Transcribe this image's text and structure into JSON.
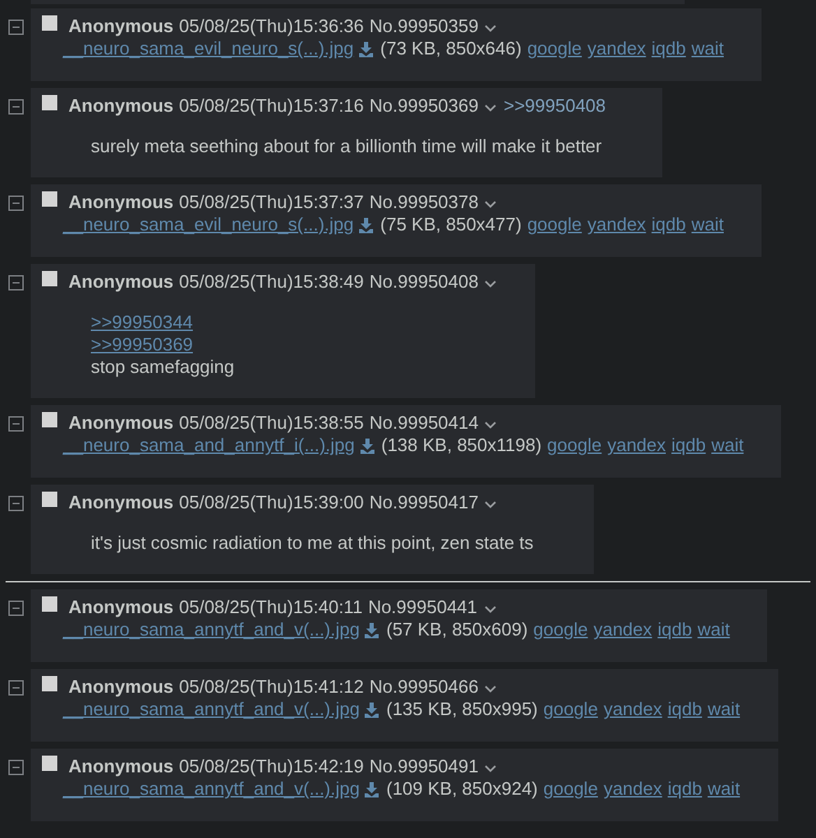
{
  "posts": [
    {
      "kind": "cut_off_post"
    },
    {
      "kind": "post",
      "name": "Anonymous",
      "datetime": "05/08/25(Thu)15:36:36",
      "number": "No.99950359",
      "checked": false,
      "file": {
        "name": "__neuro_sama_evil_neuro_s(...).jpg",
        "info": "(73 KB, 850x646)",
        "links": [
          "google",
          "yandex",
          "iqdb",
          "wait"
        ]
      }
    },
    {
      "kind": "post",
      "name": "Anonymous",
      "datetime": "05/08/25(Thu)15:37:16",
      "number": "No.99950369",
      "checked": false,
      "backlinks": [
        ">>99950408"
      ],
      "message": [
        {
          "kind": "text",
          "text": "surely meta seething about for a billionth time will make it better"
        }
      ]
    },
    {
      "kind": "post",
      "name": "Anonymous",
      "datetime": "05/08/25(Thu)15:37:37",
      "number": "No.99950378",
      "checked": false,
      "file": {
        "name": "__neuro_sama_evil_neuro_s(...).jpg",
        "info": "(75 KB, 850x477)",
        "links": [
          "google",
          "yandex",
          "iqdb",
          "wait"
        ]
      }
    },
    {
      "kind": "post",
      "name": "Anonymous",
      "datetime": "05/08/25(Thu)15:38:49",
      "number": "No.99950408",
      "checked": false,
      "message": [
        {
          "kind": "quotelink",
          "text": ">>99950344"
        },
        {
          "kind": "quotelink",
          "text": ">>99950369"
        },
        {
          "kind": "text",
          "text": "stop samefagging"
        }
      ]
    },
    {
      "kind": "post",
      "name": "Anonymous",
      "datetime": "05/08/25(Thu)15:38:55",
      "number": "No.99950414",
      "checked": false,
      "file": {
        "name": "__neuro_sama_and_annytf_i(...).jpg",
        "info": "(138 KB, 850x1198)",
        "links": [
          "google",
          "yandex",
          "iqdb",
          "wait"
        ]
      }
    },
    {
      "kind": "post",
      "name": "Anonymous",
      "datetime": "05/08/25(Thu)15:39:00",
      "number": "No.99950417",
      "checked": false,
      "message": [
        {
          "kind": "text",
          "text": "it's just cosmic radiation to me at this point, zen state ts"
        }
      ]
    },
    {
      "kind": "divider"
    },
    {
      "kind": "post",
      "name": "Anonymous",
      "datetime": "05/08/25(Thu)15:40:11",
      "number": "No.99950441",
      "checked": false,
      "file": {
        "name": "__neuro_sama_annytf_and_v(...).jpg",
        "info": "(57 KB, 850x609)",
        "links": [
          "google",
          "yandex",
          "iqdb",
          "wait"
        ]
      }
    },
    {
      "kind": "post",
      "name": "Anonymous",
      "datetime": "05/08/25(Thu)15:41:12",
      "number": "No.99950466",
      "checked": false,
      "file": {
        "name": "__neuro_sama_annytf_and_v(...).jpg",
        "info": "(135 KB, 850x995)",
        "links": [
          "google",
          "yandex",
          "iqdb",
          "wait"
        ]
      }
    },
    {
      "kind": "post",
      "name": "Anonymous",
      "datetime": "05/08/25(Thu)15:42:19",
      "number": "No.99950491",
      "checked": false,
      "file": {
        "name": "__neuro_sama_annytf_and_v(...).jpg",
        "info": "(109 KB, 850x924)",
        "links": [
          "google",
          "yandex",
          "iqdb",
          "wait"
        ]
      }
    }
  ]
}
